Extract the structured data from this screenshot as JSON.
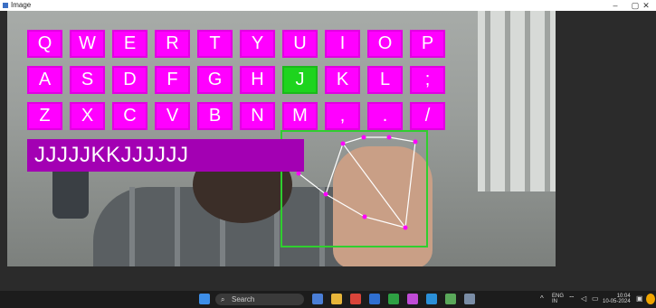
{
  "window": {
    "title": "Image",
    "controls": {
      "minimize": "–",
      "maximize": "▢",
      "close": "✕"
    }
  },
  "keyboard": {
    "rows": [
      [
        "Q",
        "W",
        "E",
        "R",
        "T",
        "Y",
        "U",
        "I",
        "O",
        "P"
      ],
      [
        "A",
        "S",
        "D",
        "F",
        "G",
        "H",
        "J",
        "K",
        "L",
        ";"
      ],
      [
        "Z",
        "X",
        "C",
        "V",
        "B",
        "N",
        "M",
        ",",
        ".",
        "/"
      ]
    ],
    "active_key": "J",
    "colors": {
      "key": "#ff00ff",
      "active": "#1ed41e",
      "text_bar": "#a300b3"
    }
  },
  "typed_text": "JJJJJKKJJJJJJ",
  "taskbar": {
    "search_placeholder": "Search",
    "tray": {
      "language_line1": "ENG",
      "language_line2": "IN",
      "time": "10:04",
      "date": "10-05-2024"
    }
  }
}
